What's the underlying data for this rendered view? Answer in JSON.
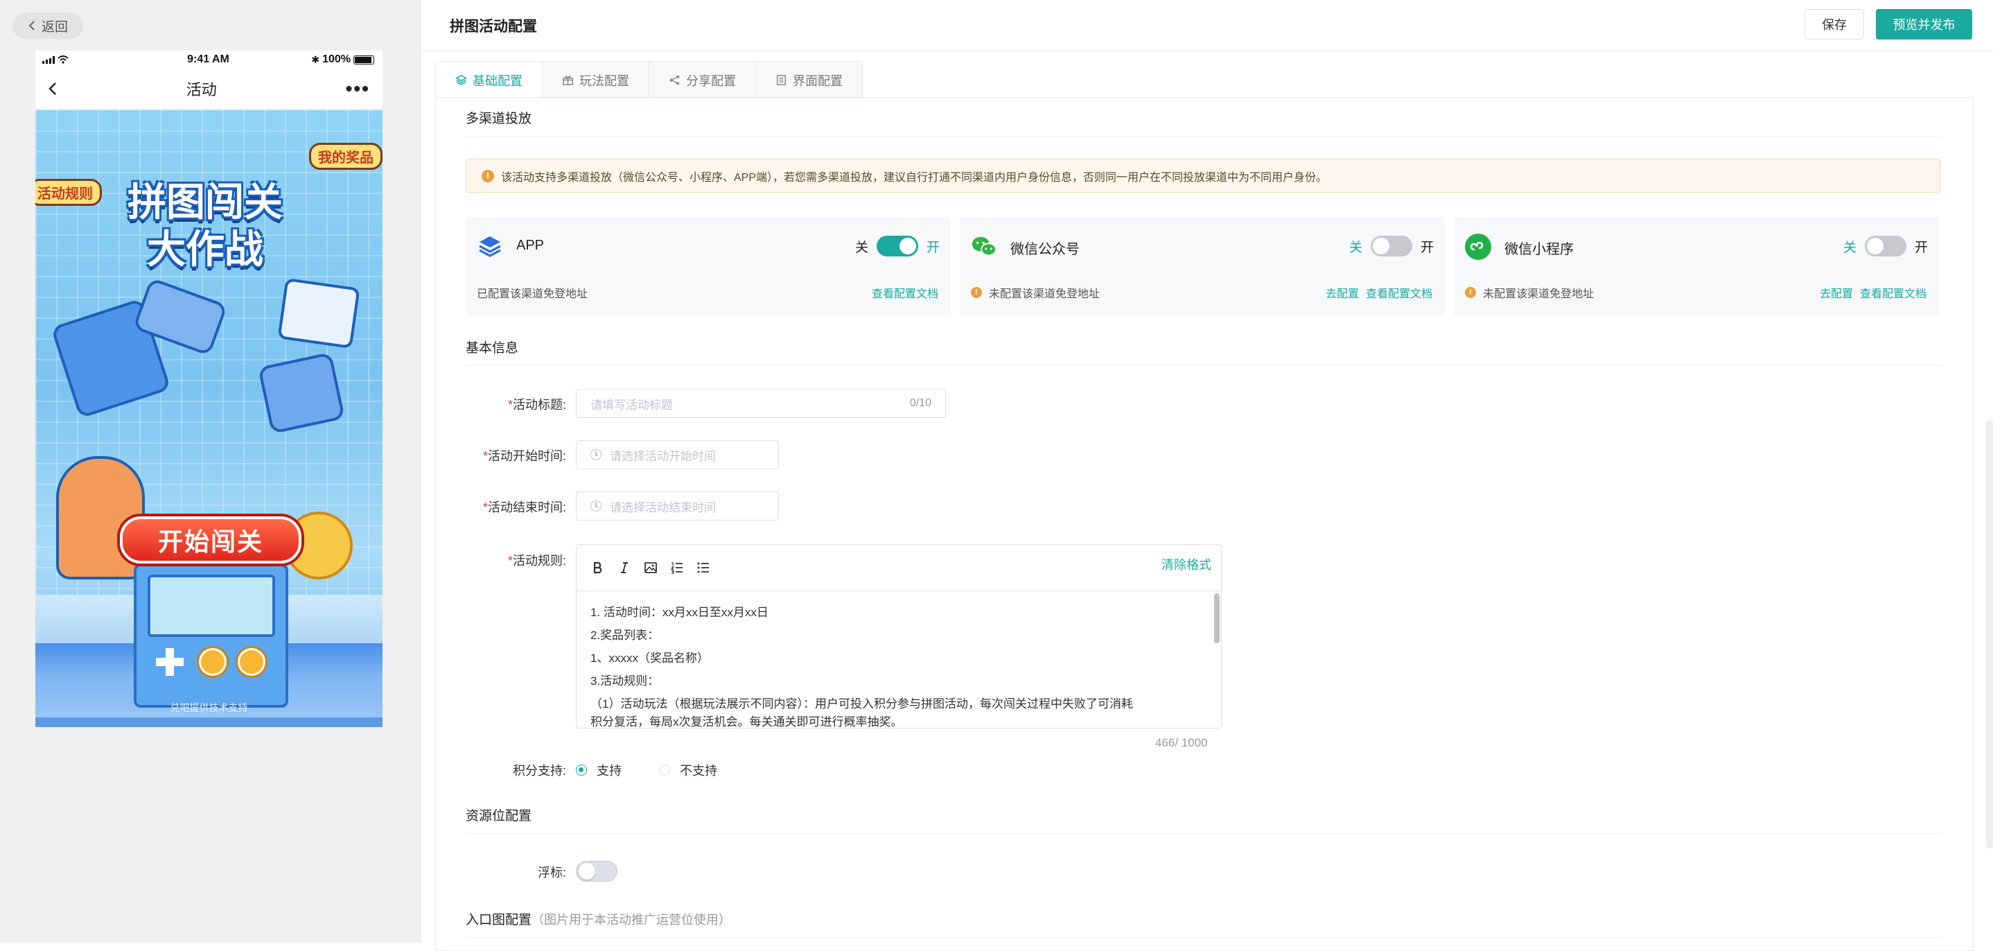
{
  "left": {
    "back_label": "返回",
    "phone": {
      "time": "9:41 AM",
      "battery": "100%",
      "nav_title": "活动",
      "nav_more": "•••",
      "poster": {
        "tag_rules": "活动规则",
        "tag_prizes": "我的奖品",
        "title_line1": "拼图闯关",
        "title_line2": "大作战",
        "start_button": "开始闯关",
        "footer": "兑吧提供技术支持"
      }
    }
  },
  "header": {
    "title": "拼图活动配置",
    "save_label": "保存",
    "publish_label": "预览并发布"
  },
  "tabs": [
    {
      "label": "基础配置",
      "active": true
    },
    {
      "label": "玩法配置",
      "active": false
    },
    {
      "label": "分享配置",
      "active": false
    },
    {
      "label": "界面配置",
      "active": false
    }
  ],
  "multichannel": {
    "section_title": "多渠道投放",
    "notice": "该活动支持多渠道投放（微信公众号、小程序、APP端），若您需多渠道投放，建议自行打通不同渠道内用户身份信息，否则同一用户在不同投放渠道中为不同用户身份。",
    "switch_off_label": "关",
    "switch_on_label": "开",
    "channels": [
      {
        "name": "APP",
        "enabled": true,
        "status": "已配置该渠道免登地址",
        "configure_link": "",
        "doc_link": "查看配置文档",
        "icon": "layers-icon"
      },
      {
        "name": "微信公众号",
        "enabled": false,
        "status": "未配置该渠道免登地址",
        "configure_link": "去配置",
        "doc_link": "查看配置文档",
        "icon": "wechat-icon"
      },
      {
        "name": "微信小程序",
        "enabled": false,
        "status": "未配置该渠道免登地址",
        "configure_link": "去配置",
        "doc_link": "查看配置文档",
        "icon": "miniprogram-icon"
      }
    ]
  },
  "basic": {
    "section_title": "基本信息",
    "title_label": "活动标题:",
    "title_placeholder": "请填写活动标题",
    "title_count": "0/10",
    "start_label": "活动开始时间:",
    "start_placeholder": "请选择活动开始时间",
    "end_label": "活动结束时间:",
    "end_placeholder": "请选择活动结束时间",
    "rules_label": "活动规则:",
    "clear_format": "清除格式",
    "rules_lines": [
      "1. 活动时间：xx月xx日至xx月xx日",
      "2.奖品列表：",
      "1、xxxxx（奖品名称）",
      "3.活动规则：",
      "（1）活动玩法（根据玩法展示不同内容）：用户可投入积分参与拼图活动，每次闯关过程中失败了可消耗",
      "积分复活，每局x次复活机会。每关通关即可进行概率抽奖。"
    ],
    "rules_count": "466/ 1000",
    "points_label": "积分支持:",
    "points_options": [
      {
        "label": "支持",
        "checked": true
      },
      {
        "label": "不支持",
        "checked": false
      }
    ]
  },
  "resource": {
    "section_title": "资源位配置",
    "float_label": "浮标:"
  },
  "entry": {
    "section_title": "入口图配置",
    "hint": "（图片用于本活动推广运营位使用）"
  },
  "colors": {
    "accent": "#1ba9a0",
    "warning": "#e6a23c",
    "required": "#e4393c"
  }
}
